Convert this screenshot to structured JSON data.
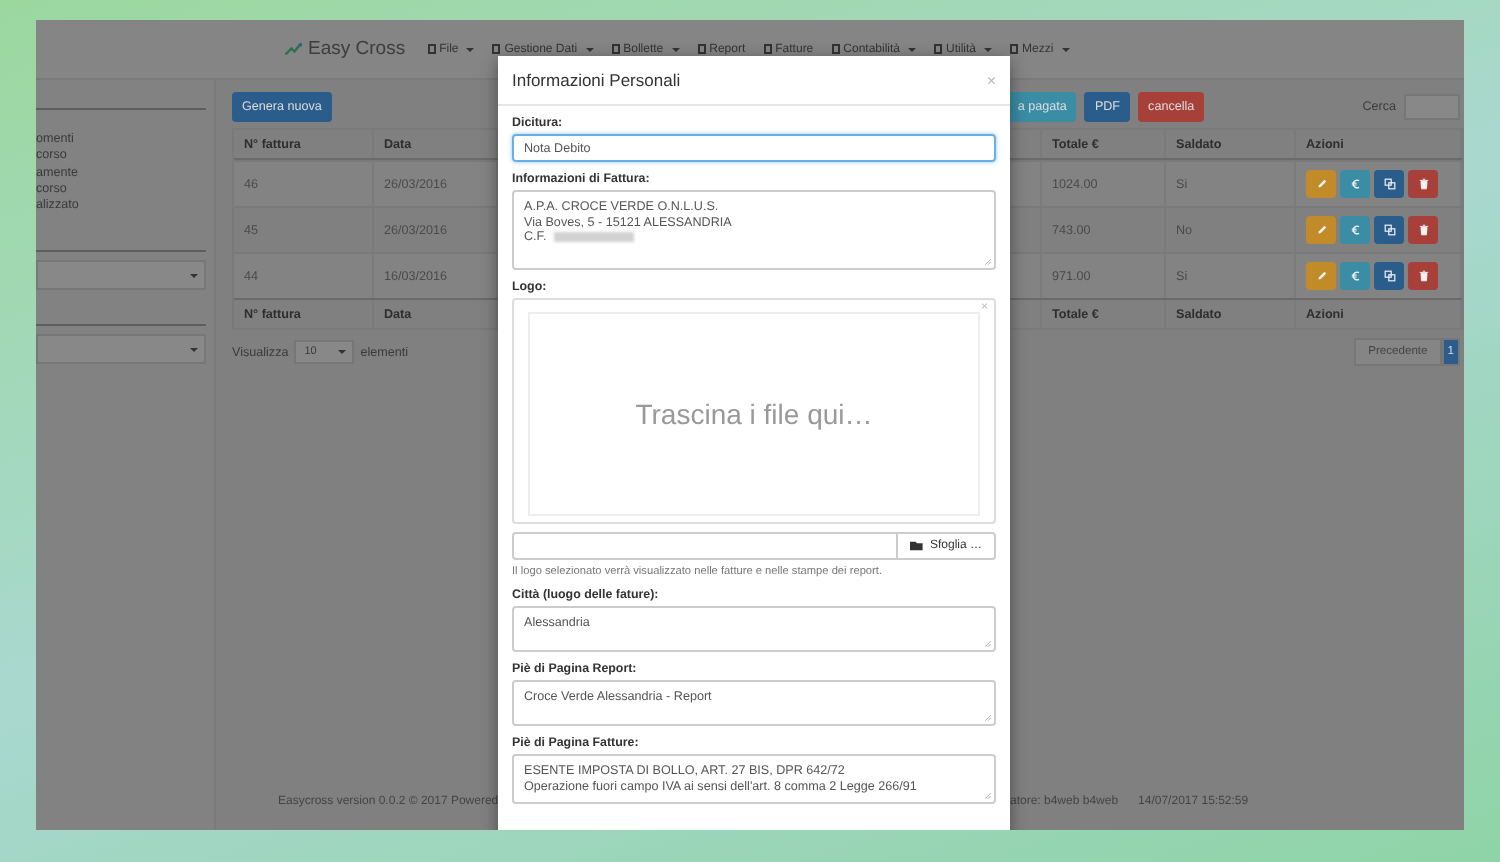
{
  "navbar": {
    "brand": "Easy Cross",
    "menus": [
      {
        "label": "File",
        "dropdown": true
      },
      {
        "label": "Gestione Dati",
        "dropdown": true
      },
      {
        "label": "Bollette",
        "dropdown": true
      },
      {
        "label": "Report",
        "dropdown": false
      },
      {
        "label": "Fatture",
        "dropdown": false
      },
      {
        "label": "Contabilità",
        "dropdown": true
      },
      {
        "label": "Utilità",
        "dropdown": true
      },
      {
        "label": "Mezzi",
        "dropdown": true
      }
    ]
  },
  "sidebar": {
    "items": [
      "omenti",
      "corso",
      "amente",
      "corso",
      "alizzato"
    ]
  },
  "toolbar": {
    "buttons": [
      {
        "label": "Genera nuova",
        "kind": "primary"
      },
      {
        "label": "a pagata",
        "kind": "info"
      },
      {
        "label": "PDF",
        "kind": "primary"
      },
      {
        "label": "cancella",
        "kind": "danger"
      }
    ],
    "search_label": "Cerca"
  },
  "table": {
    "columns": [
      "N° fattura",
      "Data",
      "Totale €",
      "Saldato",
      "Azioni"
    ],
    "rows": [
      {
        "cells": [
          "46",
          "26/03/2016",
          "1024.00",
          "Si"
        ]
      },
      {
        "cells": [
          "45",
          "26/03/2016",
          "743.00",
          "No"
        ]
      },
      {
        "cells": [
          "44",
          "16/03/2016",
          "971.00",
          "Si"
        ]
      }
    ],
    "footer_columns": [
      "N° fattura",
      "Data",
      "Totale €",
      "Saldato",
      "Azioni"
    ]
  },
  "length_menu": {
    "before": "Visualizza",
    "value": "10",
    "after": "elementi"
  },
  "pagination": [
    {
      "label": "Precedente",
      "selected": false
    },
    {
      "label": "1",
      "selected": true
    }
  ],
  "footer": {
    "version": "Easycross version 0.0.2 © 2017 Powered",
    "user": "atore: b4web b4web",
    "time": "14/07/2017 15:52:59"
  },
  "modal": {
    "title": "Informazioni Personali",
    "close": "×",
    "fields": [
      {
        "kind": "input",
        "label": "Dicitura:",
        "value": "Nota Debito",
        "focused": true
      },
      {
        "kind": "textarea",
        "label": "Informazioni di Fattura:",
        "lines": [
          "A.P.A. CROCE VERDE O.N.L.U.S.",
          "Via Boves, 5 - 15121 ALESSANDRIA",
          "C.F."
        ],
        "redacted": true,
        "focused": false
      },
      {
        "kind": "file",
        "label": "Logo:",
        "drop_text": "Trascina i file qui…",
        "remove": "×",
        "browse": "Sfoglia …",
        "help": "Il logo selezionato verrà visualizzato nelle fatture e nelle stampe dei report."
      },
      {
        "kind": "textarea",
        "label": "Città (luogo delle fature):",
        "lines": [
          "Alessandria"
        ],
        "focused": false
      },
      {
        "kind": "textarea",
        "label": "Piè di Pagina Report:",
        "lines": [
          "Croce Verde Alessandria - Report"
        ],
        "focused": false
      },
      {
        "kind": "textarea",
        "label": "Piè di Pagina Fatture:",
        "lines": [
          "ESENTE IMPOSTA DI BOLLO, ART. 27 BIS, DPR 642/72",
          "Operazione fuori campo IVA ai sensi dell'art. 8 comma 2 Legge 266/91"
        ],
        "focused": false
      }
    ]
  }
}
